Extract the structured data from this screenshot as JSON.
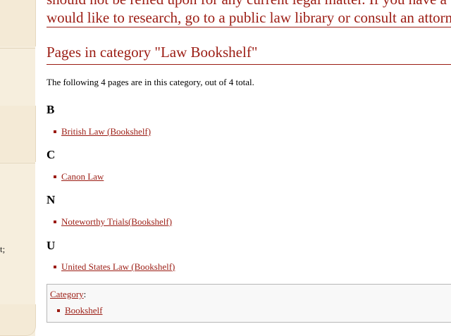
{
  "intro": {
    "line1": "should not be relied upon for any current legal matter. If you have a",
    "line2": "would like to research, go to a public law library or consult an attorn"
  },
  "category": {
    "heading": "Pages in category \"Law Bookshelf\"",
    "summary": "The following 4 pages are in this category, out of 4 total.",
    "groups": [
      {
        "letter": "B",
        "items": [
          "British Law (Bookshelf)"
        ]
      },
      {
        "letter": "C",
        "items": [
          "Canon Law"
        ]
      },
      {
        "letter": "N",
        "items": [
          "Noteworthy Trials(Bookshelf)"
        ]
      },
      {
        "letter": "U",
        "items": [
          "United States Law (Bookshelf)"
        ]
      }
    ]
  },
  "catlinks": {
    "label": "Category",
    "colon": ":",
    "items": [
      "Bookshelf"
    ]
  },
  "sidebar": {
    "fragment": "t;"
  },
  "colors": {
    "accent": "#9b1c13",
    "sidebar": "#f6eedd"
  }
}
